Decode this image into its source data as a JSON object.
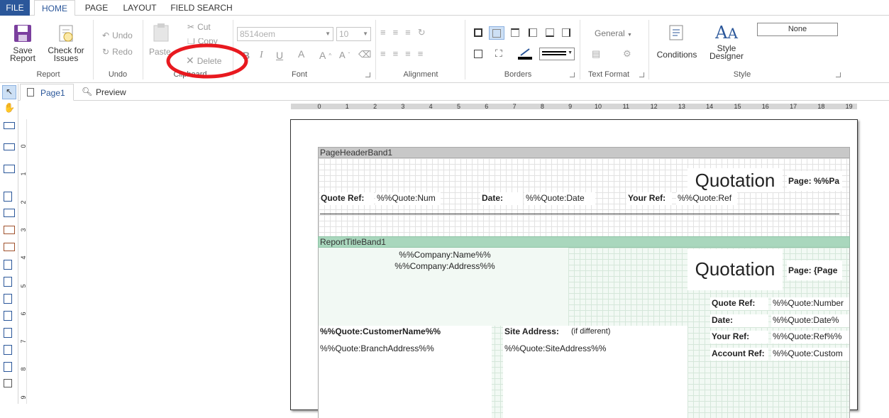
{
  "tabs": {
    "file": "FILE",
    "home": "HOME",
    "page": "PAGE",
    "layout": "LAYOUT",
    "field_search": "FIELD SEARCH"
  },
  "ribbon": {
    "report": {
      "save": "Save\nReport",
      "save_l1": "Save",
      "save_l2": "Report",
      "check_l1": "Check for",
      "check_l2": "Issues",
      "label": "Report"
    },
    "undo": {
      "undo": "Undo",
      "redo": "Redo",
      "label": "Undo"
    },
    "clipboard": {
      "paste": "Paste",
      "cut": "Cut",
      "copy": "Copy",
      "delete": "Delete",
      "label": "Clipboard"
    },
    "font": {
      "family": "8514oem",
      "size": "10",
      "label": "Font"
    },
    "alignment": {
      "label": "Alignment"
    },
    "borders": {
      "label": "Borders"
    },
    "text_format": {
      "format": "General",
      "label": "Text Format"
    },
    "style": {
      "conditions": "Conditions",
      "designer_l1": "Style",
      "designer_l2": "Designer",
      "style_value": "None",
      "label": "Style"
    }
  },
  "page_tabs": {
    "page1": "Page1",
    "preview": "Preview"
  },
  "ruler": {
    "h": [
      "0",
      "1",
      "2",
      "3",
      "4",
      "5",
      "6",
      "7",
      "8",
      "9",
      "10",
      "11",
      "12",
      "13",
      "14",
      "15",
      "16",
      "17",
      "18",
      "19"
    ],
    "v": [
      "0",
      "1",
      "2",
      "3",
      "4",
      "5",
      "6",
      "7",
      "8",
      "9"
    ]
  },
  "bands": {
    "header": {
      "title": "PageHeaderBand1",
      "quotation": "Quotation",
      "page": "Page: %%Pa",
      "quote_ref_label": "Quote Ref:",
      "quote_num": "%%Quote:Num",
      "date_label": "Date:",
      "quote_date": "%%Quote:Date",
      "your_ref_label": "Your Ref:",
      "quote_ref": "%%Quote:Ref"
    },
    "report_title": {
      "title": "ReportTitleBand1",
      "company_name": "%%Company:Name%%",
      "company_address": "%%Company:Address%%",
      "quotation": "Quotation",
      "page": "Page: {Page",
      "quote_ref_label": "Quote Ref:",
      "quote_number": "%%Quote:Number",
      "date_label": "Date:",
      "quote_date": "%%Quote:Date%",
      "your_ref_label": "Your Ref:",
      "quote_ref": "%%Quote:Ref%%",
      "account_ref_label": "Account Ref:",
      "quote_custom": "%%Quote:Custom",
      "customer_name": "%%Quote:CustomerName%%",
      "branch_address": "%%Quote:BranchAddress%%",
      "site_address_label": "Site Address:",
      "if_different": "(if different)",
      "site_address": "%%Quote:SiteAddress%%"
    }
  },
  "colors": {
    "file_tab": "#2b579a",
    "header_band": "#c8c8c8",
    "title_band": "#a9d7bd",
    "annotation": "#e8191f"
  }
}
